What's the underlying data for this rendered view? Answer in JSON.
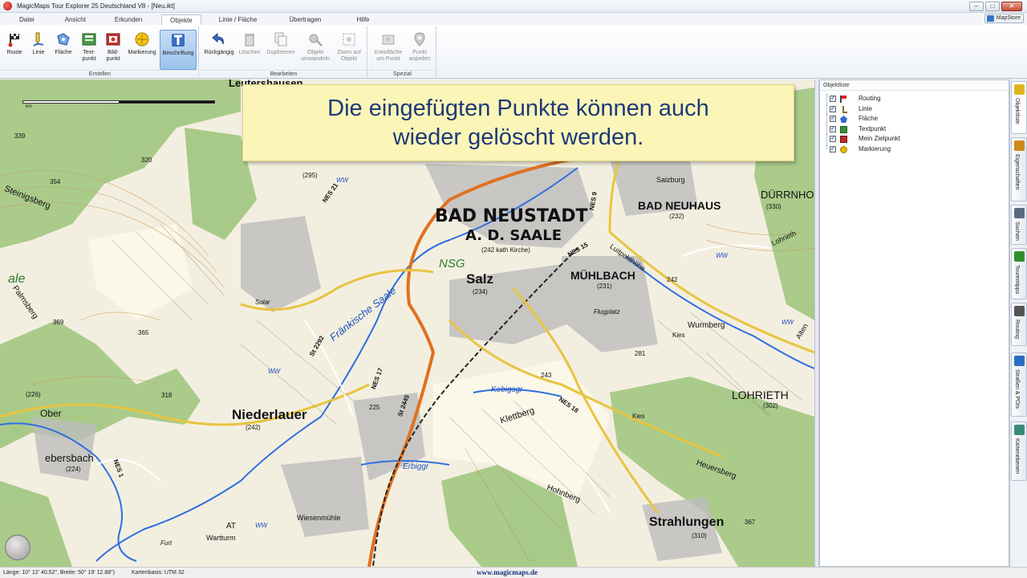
{
  "window": {
    "title": "MagicMaps Tour Explorer 25 Deutschland V8 - [Neu.ikt]",
    "controls": [
      "–",
      "□",
      "✕"
    ]
  },
  "menu": {
    "tabs": [
      "Datei",
      "Ansicht",
      "Erkunden",
      "Objekte",
      "Linie / Fläche",
      "Übertragen",
      "Hilfe"
    ],
    "active": "Objekte",
    "mapstore": "MapStore"
  },
  "ribbon": {
    "groups": {
      "erstellen": "Erstellen",
      "bearbeiten": "Bearbeiten",
      "spezial": "Spezial"
    },
    "buttons": {
      "route": "Route",
      "linie": "Linie",
      "flaeche": "Fläche",
      "textpunkt": "Text-\npunkt",
      "bildpunkt": "Bild-\npunkt",
      "markierung": "Markierung",
      "beschriftung": "Beschriftung",
      "rueckgaengig": "Rückgängig",
      "loeschen": "Löschen",
      "duplizieren": "Duplizieren",
      "objekt_umwandeln": "Objekt\numwandeln",
      "zoom_auf_objekt": "Zoom auf\nObjekt",
      "kreisflaeche": "Kreisfläche\num Punkt",
      "punkt_anpeilen": "Punkt\nanpeilen"
    }
  },
  "map": {
    "banner_line1": "Die eingefügten Punkte können auch",
    "banner_line2": "wieder gelöscht werden.",
    "scale_unit": "km",
    "labels": {
      "bad_neustadt_1": "BAD NEUSTADT",
      "bad_neustadt_2": "A. D. SAALE",
      "bad_neustadt_sub": "(242 kath Kirche)",
      "salz": "Salz",
      "salz_elev": "(234)",
      "muehlbach": "MÜHLBACH",
      "muehlbach_elev": "(231)",
      "bad_neuhaus": "BAD NEUHAUS",
      "bad_neuhaus_elev": "(232)",
      "duerrnhof": "DÜRRNHOF",
      "duerrnhof_elev": "(330)",
      "lohrieth": "LOHRIETH",
      "lohrieth_elev": "(302)",
      "niederlauer": "Niederlauer",
      "niederlauer_elev": "(242)",
      "strahlungen": "Strahlungen",
      "strahlungen_elev": "(310)",
      "nsg": "NSG",
      "fraenkische_saale": "Fränkische Saale",
      "kebigsgr": "Kebigsgr",
      "erbiggr": "Erbiggr",
      "wurmberg": "Wurmberg",
      "klettberg": "Klettberg",
      "hohnberg": "Hohnberg",
      "heuersberg": "Heuersberg",
      "steinigsberg": "Steinigsberg",
      "palmsberg": "Palmsberg",
      "ebersbach": "ebersbach",
      "ebersbach_elev": "(224)",
      "ober": "Ober",
      "flugplatz": "Flugplatz",
      "salzburg": "Salzburg",
      "kies1": "Kies",
      "kies2": "Kies",
      "solar": "Solar",
      "wiesenmuehle": "Wiesenmühle",
      "warttum": "Wartturm",
      "furt": "Furt",
      "leutershausen": "Leutershausen",
      "e339": "339",
      "e354": "354",
      "e320": "320",
      "e369": "369",
      "e365": "365",
      "e318": "318",
      "e226": "(226)",
      "e225": "225",
      "e243": "243",
      "e281": "281",
      "e242": "242",
      "e367": "367",
      "e295": "(295)",
      "road_nes21": "NES 21",
      "road_nes15": "NES 15",
      "road_nes17": "NES 17",
      "road_nes18": "NES 18",
      "road_nes1": "NES 1",
      "road_st2292": "St 2292",
      "road_st2445": "St 2445",
      "road_nes9": "NES 9",
      "luitpoldhoehe": "Luitpoldhöhe",
      "lohriethr": "Lohrieth",
      "alten": "Alten",
      "saale_left": "ale",
      "ww1": "WW",
      "ww2": "WW",
      "ww3": "WW",
      "ww4": "WW",
      "ww5": "WW",
      "at": "AT"
    }
  },
  "objects_panel": {
    "title": "Objektliste",
    "items": [
      {
        "label": "Routing",
        "icon": "routing-flag-icon",
        "color": "#444444"
      },
      {
        "label": "Linie",
        "icon": "line-icon",
        "color": "#8a6a30"
      },
      {
        "label": "Fläche",
        "icon": "area-icon",
        "color": "#2b6cc4"
      },
      {
        "label": "Textpunkt",
        "icon": "textpoint-icon",
        "color": "#3b8f3b"
      },
      {
        "label": "Mein Zielpunkt",
        "icon": "photo-point-icon",
        "color": "#c02828"
      },
      {
        "label": "Markierung",
        "icon": "marker-icon",
        "color": "#e6b800"
      }
    ]
  },
  "side_tabs": [
    {
      "label": "Objektliste",
      "color": "#e0b520"
    },
    {
      "label": "Eigenschaften",
      "color": "#d08a1a"
    },
    {
      "label": "Suchen",
      "color": "#5a6a80"
    },
    {
      "label": "Tourentipps",
      "color": "#2f8f2f"
    },
    {
      "label": "Routing",
      "color": "#555555"
    },
    {
      "label": "Straßen & POIs",
      "color": "#2b6cc4"
    },
    {
      "label": "Kartenebenen",
      "color": "#3a8a7a"
    }
  ],
  "status": {
    "coords": "Länge: 10° 12' 40.52\", Breite: 50° 19' 12.88\")",
    "basis": "Kartenbasis: UTM 32",
    "url": "www.magicmaps.de"
  }
}
